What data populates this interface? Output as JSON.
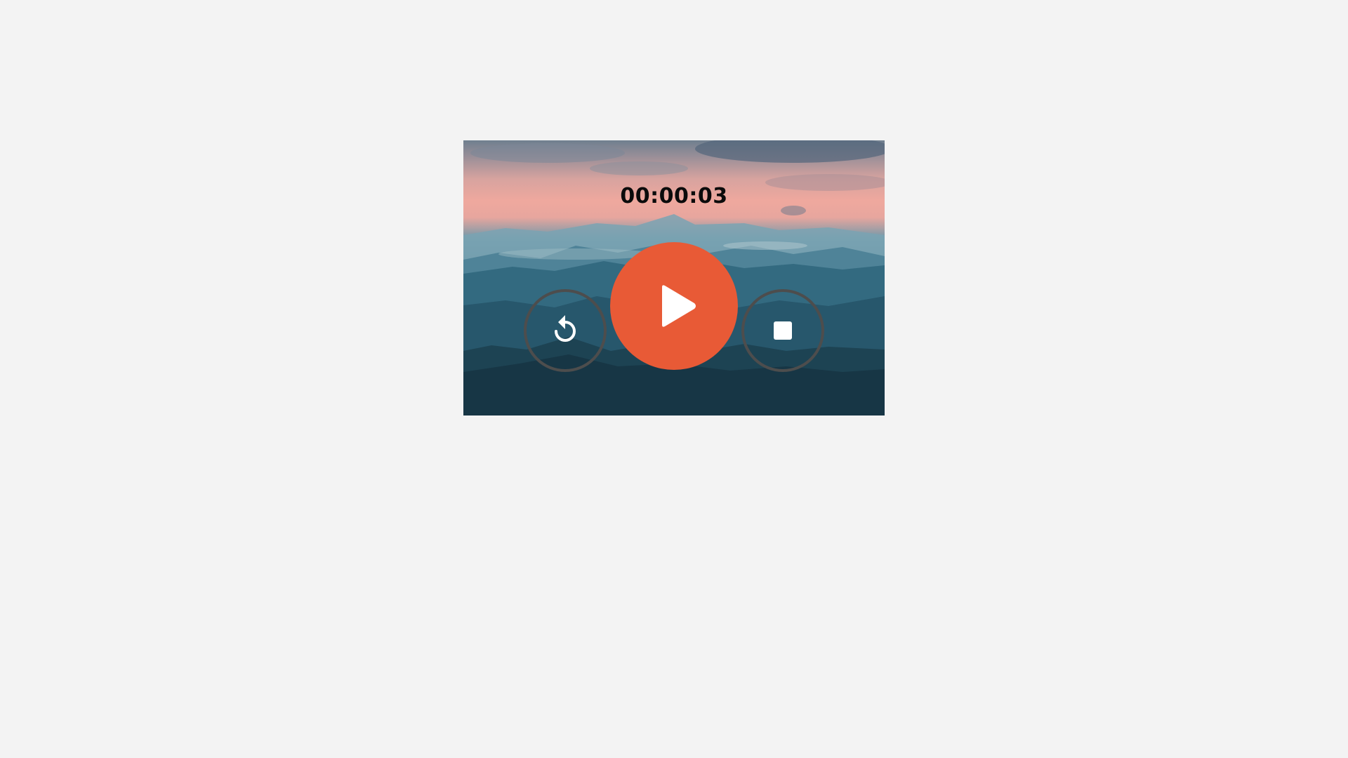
{
  "timer": {
    "display": "00:00:03"
  },
  "controls": {
    "reset": {
      "icon": "reset-icon"
    },
    "play": {
      "icon": "play-icon"
    },
    "stop": {
      "icon": "stop-icon"
    }
  },
  "colors": {
    "page_background": "#f3f3f3",
    "play_button": "#e85a36",
    "side_button_ring": "#4d4d4d",
    "icon": "#ffffff",
    "timer_text": "#0b0b0b"
  }
}
